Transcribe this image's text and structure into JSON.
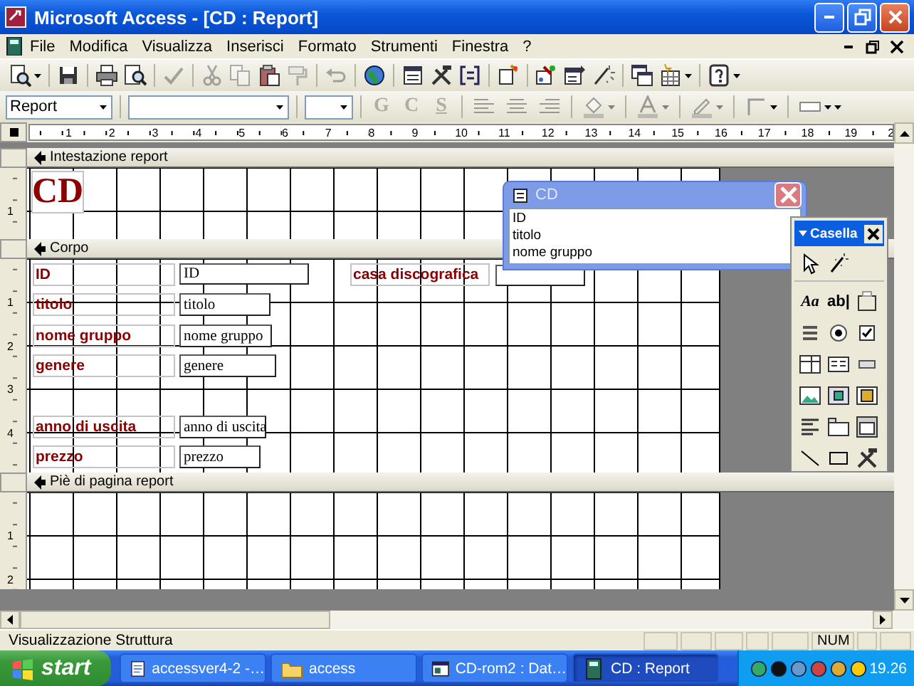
{
  "window": {
    "title": "Microsoft Access - [CD : Report]"
  },
  "menu": {
    "items": [
      "File",
      "Modifica",
      "Visualizza",
      "Inserisci",
      "Formato",
      "Strumenti",
      "Finestra",
      "?"
    ]
  },
  "toolbar": {
    "buttons": [
      {
        "kind": "preview",
        "disabled": false
      },
      {
        "kind": "save",
        "disabled": false
      },
      {
        "kind": "print",
        "disabled": false
      },
      {
        "kind": "printpreview",
        "disabled": false
      },
      {
        "kind": "spell",
        "disabled": true
      },
      {
        "kind": "cut",
        "disabled": true
      },
      {
        "kind": "copy",
        "disabled": true
      },
      {
        "kind": "paste",
        "disabled": false
      },
      {
        "kind": "painter",
        "disabled": true
      },
      {
        "kind": "undo",
        "disabled": true
      },
      {
        "kind": "hyperlink",
        "disabled": false
      },
      {
        "kind": "fieldlist",
        "disabled": false
      },
      {
        "kind": "toolbox",
        "disabled": false
      },
      {
        "kind": "sorting",
        "disabled": false
      },
      {
        "kind": "autoformat",
        "disabled": false
      },
      {
        "kind": "code",
        "disabled": false
      },
      {
        "kind": "properties",
        "disabled": false
      },
      {
        "kind": "build",
        "disabled": false
      },
      {
        "kind": "database",
        "disabled": false
      },
      {
        "kind": "newobject",
        "disabled": false
      },
      {
        "kind": "help",
        "disabled": false
      }
    ]
  },
  "format_bar": {
    "object": "Report",
    "styles": [
      {
        "label": "G",
        "disabled": true
      },
      {
        "label": "C",
        "disabled": true
      },
      {
        "label": "S",
        "disabled": true
      }
    ]
  },
  "ruler": {
    "marks": [
      "1",
      "2",
      "3",
      "4",
      "5",
      "6",
      "7",
      "8",
      "9",
      "10",
      "11",
      "12",
      "13",
      "14",
      "15",
      "16",
      "17",
      "18",
      "19",
      "2"
    ]
  },
  "sections": [
    {
      "kind": "header",
      "title": "Intestazione report",
      "ruler": [
        "1"
      ],
      "controls": [
        {
          "kind": "title",
          "text": "CD"
        }
      ]
    },
    {
      "kind": "body",
      "title": "Corpo",
      "ruler": [
        "1",
        "2",
        "3",
        "4"
      ],
      "controls": [
        {
          "kind": "label",
          "text": "ID"
        },
        {
          "kind": "textbox",
          "text": "ID"
        },
        {
          "kind": "label",
          "text": "casa discografica"
        },
        {
          "kind": "textbox"
        },
        {
          "kind": "label",
          "text": "titolo"
        },
        {
          "kind": "textbox",
          "text": "titolo"
        },
        {
          "kind": "label",
          "text": "nome gruppo"
        },
        {
          "kind": "textbox",
          "text": "nome gruppo"
        },
        {
          "kind": "label",
          "text": "genere"
        },
        {
          "kind": "textbox",
          "text": "genere"
        },
        {
          "kind": "label",
          "text": "anno di uscita"
        },
        {
          "kind": "textbox",
          "text": "anno di uscita"
        },
        {
          "kind": "label",
          "text": "prezzo"
        },
        {
          "kind": "textbox",
          "text": "prezzo"
        }
      ]
    },
    {
      "kind": "footer",
      "title": "Piè di pagina report",
      "ruler": [
        "1",
        "2"
      ]
    }
  ],
  "field_list": {
    "title": "CD",
    "fields": [
      "ID",
      "titolo",
      "nome gruppo"
    ]
  },
  "toolbox": {
    "title": "Casella",
    "tools": [
      {
        "kind": "pointer"
      },
      {
        "kind": "wizard"
      },
      {
        "kind": "label",
        "glyph": "Aa"
      },
      {
        "kind": "textbox",
        "glyph": "ab|"
      },
      {
        "kind": "group"
      },
      {
        "kind": "toggle"
      },
      {
        "kind": "option"
      },
      {
        "kind": "checkbox"
      },
      {
        "kind": "combo"
      },
      {
        "kind": "list"
      },
      {
        "kind": "command"
      },
      {
        "kind": "image"
      },
      {
        "kind": "unbound"
      },
      {
        "kind": "bound"
      },
      {
        "kind": "pagebreak"
      },
      {
        "kind": "tab"
      },
      {
        "kind": "subform"
      },
      {
        "kind": "line"
      },
      {
        "kind": "rectangle"
      },
      {
        "kind": "more"
      }
    ]
  },
  "status_bar": {
    "text": "Visualizzazione Struttura",
    "indicators": [
      "NUM"
    ]
  },
  "taskbar": {
    "start": "start",
    "tasks": [
      {
        "kind": "document",
        "label": "accessver4-2 -…",
        "selected": false
      },
      {
        "kind": "folder",
        "label": "access",
        "selected": false
      },
      {
        "kind": "database",
        "label": "CD-rom2 : Dat…",
        "selected": false
      },
      {
        "kind": "report",
        "label": "CD : Report",
        "selected": true
      }
    ],
    "clock": "19.26"
  }
}
